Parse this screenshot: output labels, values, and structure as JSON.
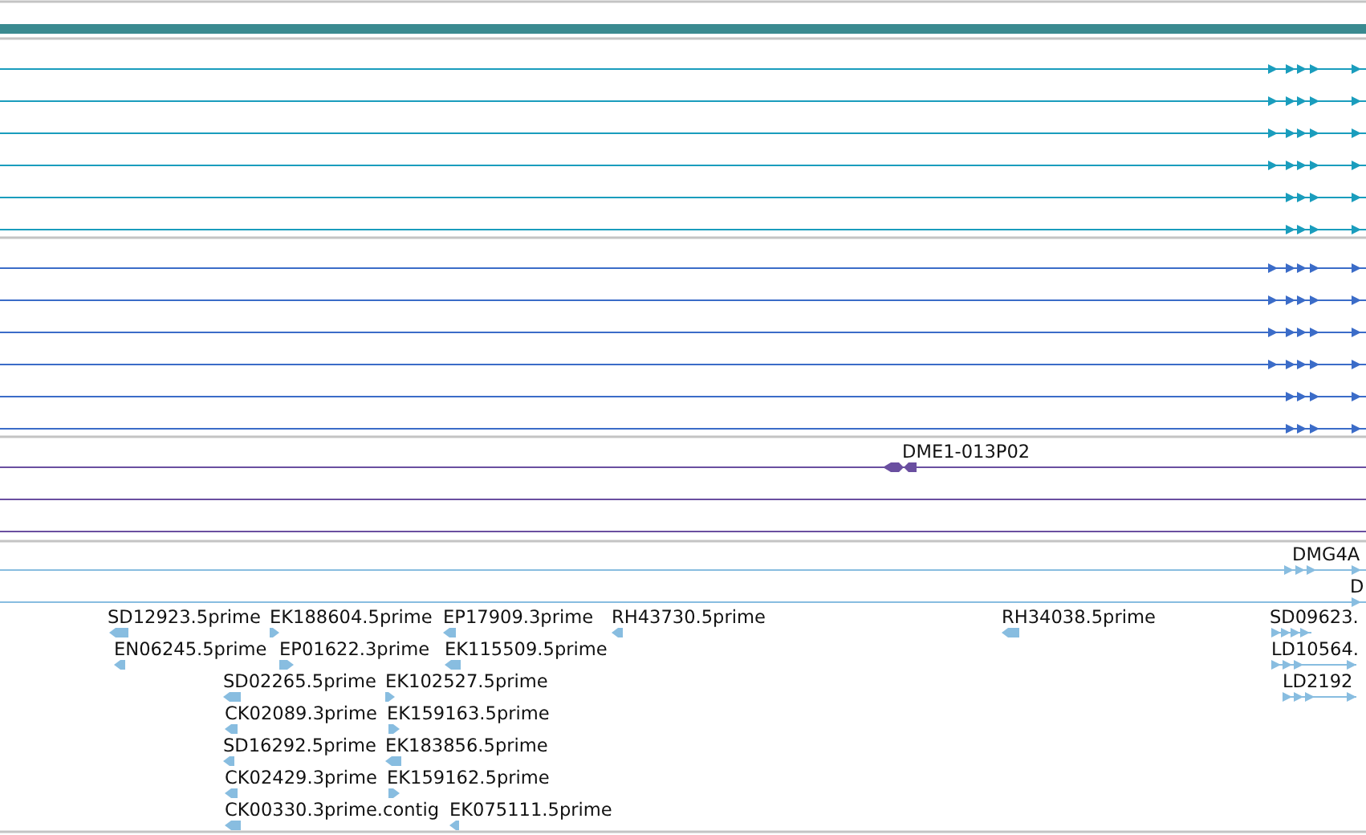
{
  "tracks": [
    {
      "kind": "transcripts",
      "color": "#1a9dbd",
      "rows": [
        {
          "reverse": false
        },
        {
          "reverse": false
        },
        {
          "reverse": false
        },
        {
          "reverse": false
        },
        {
          "reverse": false
        },
        {
          "reverse": false
        }
      ]
    },
    {
      "kind": "transcripts",
      "color": "#3b6cc8",
      "rows": [
        {
          "reverse": false
        },
        {
          "reverse": false
        },
        {
          "reverse": false
        },
        {
          "reverse": false
        },
        {
          "reverse": false
        },
        {
          "reverse": false
        }
      ]
    },
    {
      "kind": "clones",
      "color": "#6a4fa0",
      "rows": [
        {
          "label": "DME1-013P02",
          "feature": true,
          "reverse": true
        },
        {
          "feature": false
        },
        {
          "feature": false
        }
      ]
    },
    {
      "kind": "ests",
      "color": "#88bde0",
      "rows": [
        {
          "label": "DMG4A",
          "reverse": false
        },
        {
          "label": "D",
          "reverse": false
        }
      ],
      "features": [
        {
          "label": "SD12923.5prime",
          "reverse": true
        },
        {
          "label": "EK188604.5prime",
          "reverse": false
        },
        {
          "label": "EP17909.3prime",
          "reverse": true
        },
        {
          "label": "RH43730.5prime",
          "reverse": true
        },
        {
          "label": "RH34038.5prime",
          "reverse": true
        },
        {
          "label": "SD09623.",
          "reverse": false
        },
        {
          "label": "EN06245.5prime",
          "reverse": true
        },
        {
          "label": "EP01622.3prime",
          "reverse": false
        },
        {
          "label": "EK115509.5prime",
          "reverse": true
        },
        {
          "label": "LD10564.",
          "reverse": false
        },
        {
          "label": "SD02265.5prime",
          "reverse": true
        },
        {
          "label": "EK102527.5prime",
          "reverse": false
        },
        {
          "label": "LD2192",
          "reverse": false
        },
        {
          "label": "CK02089.3prime",
          "reverse": true
        },
        {
          "label": "EK159163.5prime",
          "reverse": false
        },
        {
          "label": "SD16292.5prime",
          "reverse": true
        },
        {
          "label": "EK183856.5prime",
          "reverse": true
        },
        {
          "label": "CK02429.3prime",
          "reverse": true
        },
        {
          "label": "EK159162.5prime",
          "reverse": false
        },
        {
          "label": "CK00330.3prime.contig",
          "reverse": true
        },
        {
          "label": "EK075111.5prime",
          "reverse": true
        }
      ]
    }
  ]
}
